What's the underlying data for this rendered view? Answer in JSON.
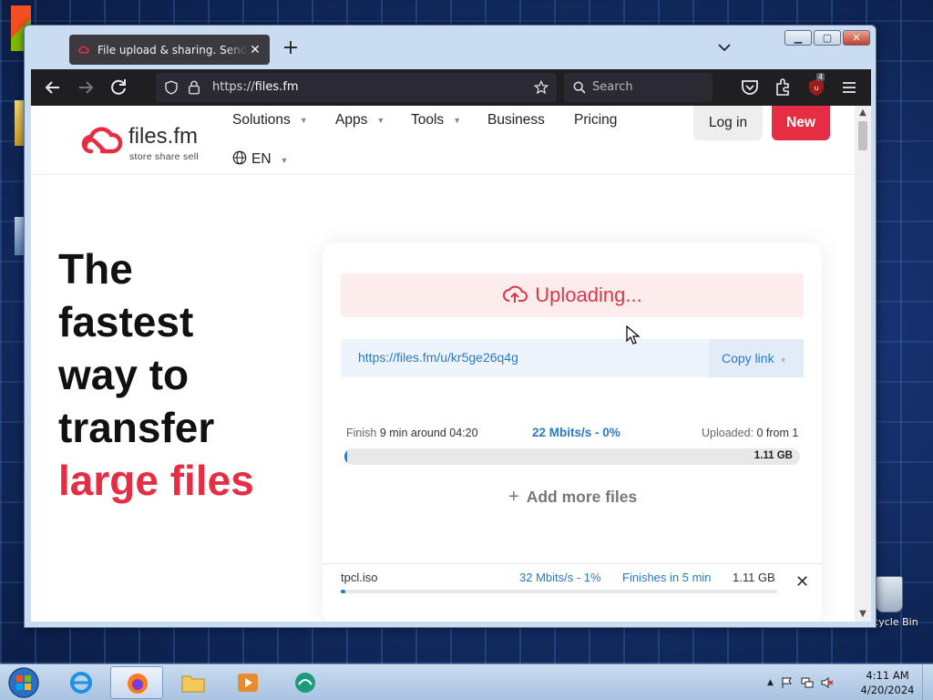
{
  "desktop": {
    "recycle_bin_label": "Recycle Bin"
  },
  "browser": {
    "tab_title": "File upload & sharing. Send large files",
    "url_scheme": "https://",
    "url_host": "files.fm",
    "search_placeholder": "Search",
    "extension_badge": "4"
  },
  "site": {
    "brand": "files.fm",
    "tagline": "store  share  sell",
    "nav": [
      {
        "label": "Solutions"
      },
      {
        "label": "Apps"
      },
      {
        "label": "Tools"
      },
      {
        "label": "Business"
      },
      {
        "label": "Pricing"
      }
    ],
    "login_label": "Log in",
    "new_label": "New",
    "language": "EN"
  },
  "hero": {
    "line1": "The",
    "line2": "fastest",
    "line3": "way to",
    "line4": "transfer",
    "accent": "large files"
  },
  "upload": {
    "status": "Uploading...",
    "link": "https://files.fm/u/kr5ge26q4g",
    "copy_label": "Copy link",
    "finish_label": "Finish",
    "finish_value": "9 min around 04:20",
    "speed": "22 Mbits/s - 0%",
    "uploaded_label": "Uploaded:",
    "uploaded_value": "0 from 1",
    "total_size": "1.11 GB",
    "progress_fraction": 0.0,
    "add_more_label": "Add more files",
    "file": {
      "name": "tpcl.iso",
      "speed": "32 Mbits/s - 1%",
      "eta": "Finishes in 5 min",
      "size": "1.11 GB",
      "progress_fraction": 0.01
    }
  },
  "taskbar": {
    "time": "4:11 AM",
    "date": "4/20/2024"
  },
  "colors": {
    "accent_red": "#e52d44",
    "link_blue": "#2c79c2",
    "upload_bg": "#fdecec"
  }
}
